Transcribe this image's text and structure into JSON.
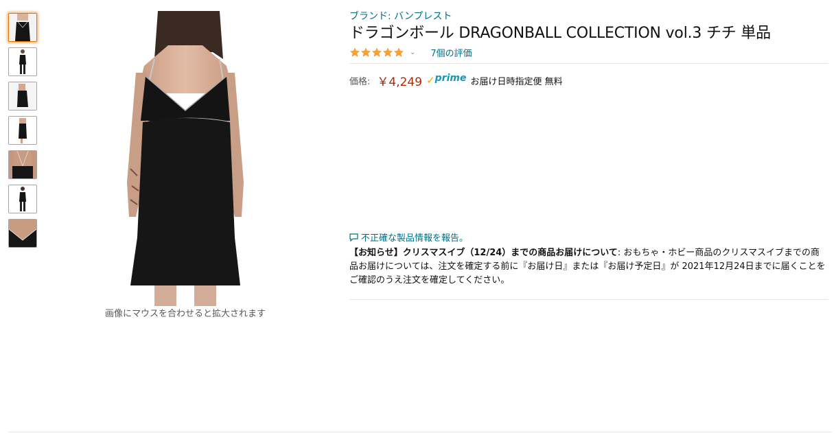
{
  "thumbnails": [
    {
      "alt": "front-view",
      "selected": true
    },
    {
      "alt": "full-body-front",
      "selected": false
    },
    {
      "alt": "side-view",
      "selected": false
    },
    {
      "alt": "full-body-side",
      "selected": false
    },
    {
      "alt": "back-view",
      "selected": false
    },
    {
      "alt": "full-body-back",
      "selected": false
    },
    {
      "alt": "neckline-detail",
      "selected": false
    }
  ],
  "image": {
    "hover_hint": "画像にマウスを合わせると拡大されます"
  },
  "product": {
    "brand": "ブランド: バンプレスト",
    "title": "ドラゴンボール DRAGONBALL COLLECTION vol.3 チチ 単品",
    "rating_value": 5,
    "rating_count": "7個の評価",
    "price_label": "価格:",
    "price": "￥4,249",
    "prime_check": "✓",
    "prime_label": "prime",
    "delivery": "お届け日時指定便 無料",
    "report_link": "不正確な製品情報を報告。",
    "notice_title": "【お知らせ】クリスマスイブ（12/24）までの商品お届けについて",
    "notice_body": ": おもちゃ・ホビー商品のクリスマスイブまでの商品お届けについては、注文を確定する前に『お届け日』または『お届け予定日』が 2021年12月24日までに届くことをご確認のうえ注文を確定してください。"
  },
  "colors": {
    "link": "#007185",
    "price": "#b12704",
    "prime": "#1399b5",
    "star": "#ffa41c",
    "selected_thumb": "#e77600"
  }
}
